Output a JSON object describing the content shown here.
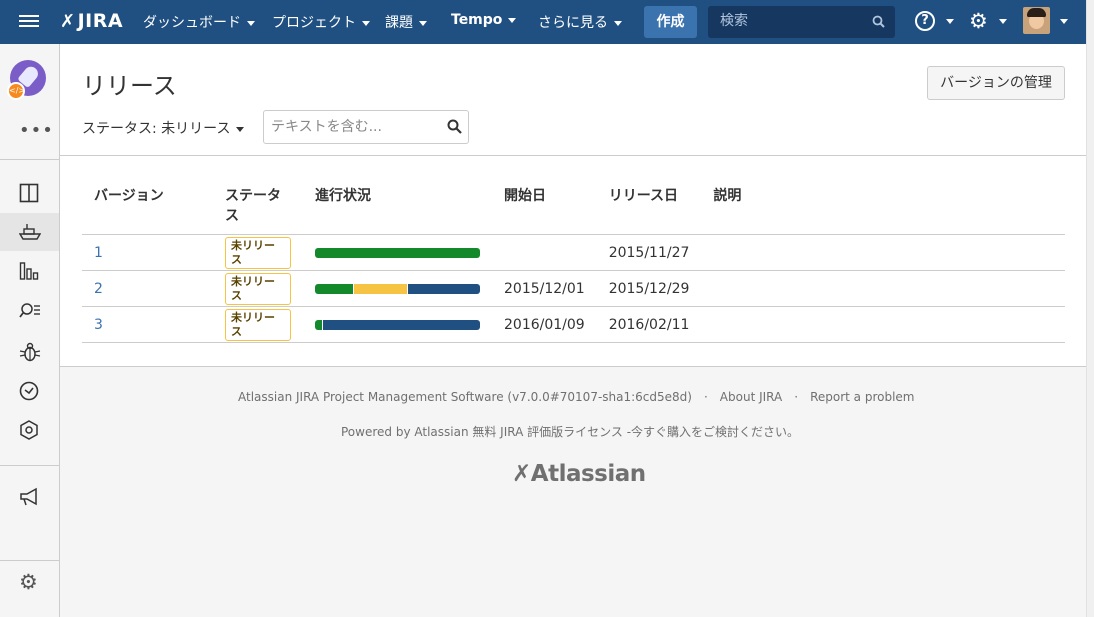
{
  "topnav": {
    "logo": "JIRA",
    "items": [
      {
        "label": "ダッシュボード"
      },
      {
        "label": "プロジェクト"
      },
      {
        "label": "課題"
      },
      {
        "label": "Tempo"
      },
      {
        "label": "さらに見る"
      }
    ],
    "create_label": "作成",
    "search_placeholder": "検索",
    "help_glyph": "?"
  },
  "sidebar": {
    "more": "•••",
    "items": [
      {
        "name": "board",
        "active": false
      },
      {
        "name": "releases",
        "active": true
      },
      {
        "name": "reports",
        "active": false
      },
      {
        "name": "issues",
        "active": false
      },
      {
        "name": "bug",
        "active": false
      },
      {
        "name": "clock",
        "active": false
      },
      {
        "name": "components",
        "active": false
      },
      {
        "name": "announcement",
        "active": false
      },
      {
        "name": "settings",
        "active": false
      }
    ]
  },
  "page": {
    "title": "リリース",
    "manage_versions_label": "バージョンの管理",
    "status_filter_label": "ステータス: 未リリース",
    "text_filter_placeholder": "テキストを含む..."
  },
  "table": {
    "headers": {
      "version": "バージョン",
      "status": "ステータス",
      "progress": "進行状況",
      "start_date": "開始日",
      "release_date": "リリース日",
      "description": "説明"
    },
    "rows": [
      {
        "version": "1",
        "status": "未リリース",
        "progress": {
          "done": 100,
          "inprogress": 0,
          "todo": 0
        },
        "start_date": "",
        "release_date": "2015/11/27",
        "description": ""
      },
      {
        "version": "2",
        "status": "未リリース",
        "progress": {
          "done": 23.5,
          "inprogress": 32.5,
          "todo": 44
        },
        "start_date": "2015/12/01",
        "release_date": "2015/12/29",
        "description": ""
      },
      {
        "version": "3",
        "status": "未リリース",
        "progress": {
          "done": 4.5,
          "inprogress": 0,
          "todo": 95.5
        },
        "start_date": "2016/01/09",
        "release_date": "2016/02/11",
        "description": ""
      }
    ]
  },
  "colors": {
    "header_bg": "#205081",
    "done": "#14892c",
    "inprogress": "#f6c342",
    "todo": "#205081",
    "link": "#3b73af"
  },
  "footer": {
    "software": "Atlassian JIRA Project Management Software (v7.0.0#70107-sha1:6cd5e8d)",
    "sep": "·",
    "about": "About JIRA",
    "report": "Report a problem",
    "powered": "Powered by Atlassian 無料 JIRA 評価版ライセンス -今すぐ購入をご検討ください。",
    "logo_text": "Atlassian"
  }
}
